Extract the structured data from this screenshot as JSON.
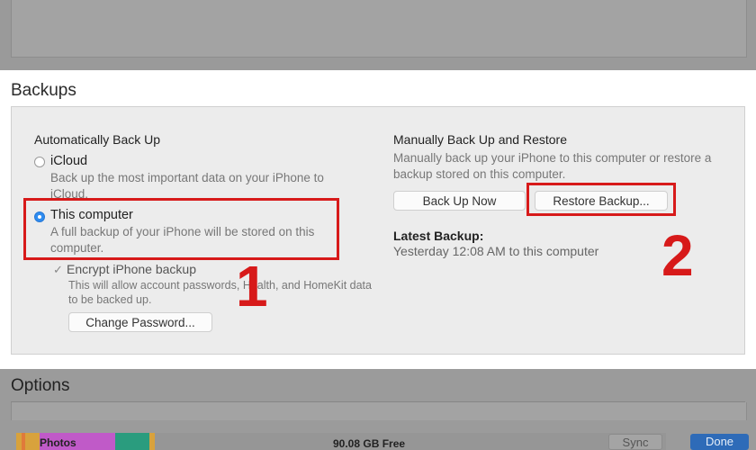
{
  "backups": {
    "title": "Backups",
    "auto": {
      "heading": "Automatically Back Up",
      "icloud": {
        "label": "iCloud",
        "desc": "Back up the most important data on your iPhone to iCloud.",
        "selected": false
      },
      "computer": {
        "label": "This computer",
        "desc": "A full backup of your iPhone will be stored on this computer.",
        "selected": true
      },
      "encrypt": {
        "label": "Encrypt iPhone backup",
        "checked": true,
        "desc": "This will allow account passwords, Health, and HomeKit data to be backed up."
      },
      "change_password": "Change Password..."
    },
    "manual": {
      "heading": "Manually Back Up and Restore",
      "desc": "Manually back up your iPhone to this computer or restore a backup stored on this computer.",
      "back_up_now": "Back Up Now",
      "restore_backup": "Restore Backup...",
      "latest_heading": "Latest Backup:",
      "latest_value": "Yesterday 12:08 AM to this computer"
    },
    "markers": {
      "one": "1",
      "two": "2"
    }
  },
  "options": {
    "title": "Options"
  },
  "footer": {
    "storage_photos": "Photos",
    "storage_free": "90.08 GB Free",
    "sync": "Sync",
    "done": "Done"
  },
  "colors": {
    "highlight_red": "#d71a1a",
    "radio_selected": "#2e8cf0",
    "done_button": "#2e6bb8",
    "photos_segment": "#c05ac8",
    "audio_segment": "#2a9c7e",
    "other_segment": "#d8a23c"
  }
}
